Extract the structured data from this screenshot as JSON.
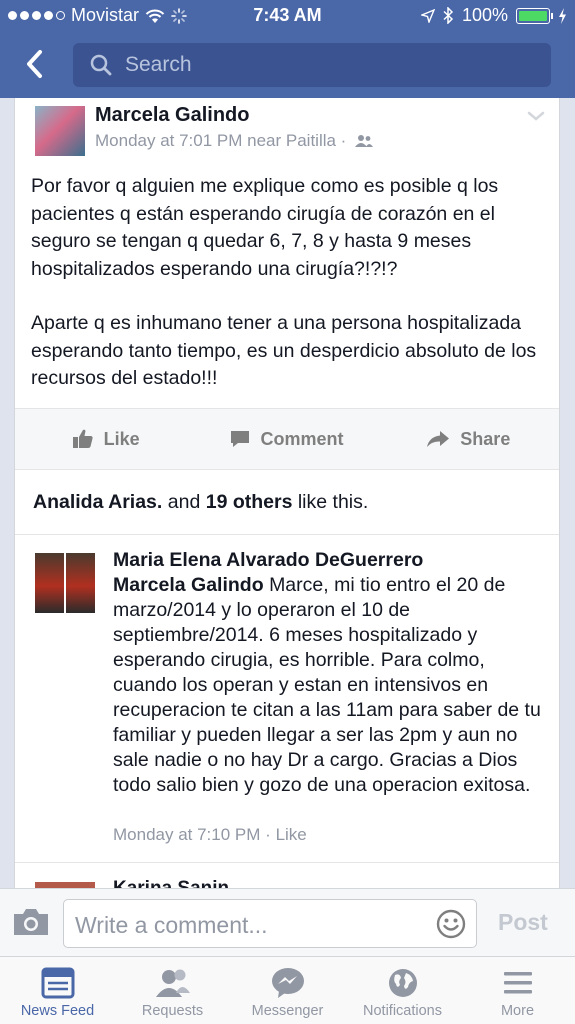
{
  "status_bar": {
    "carrier": "Movistar",
    "time": "7:43 AM",
    "battery": "100%"
  },
  "header": {
    "search_placeholder": "Search"
  },
  "post": {
    "author": "Marcela Galindo",
    "meta": "Monday at 7:01 PM near Paitilla ·",
    "paragraphs": [
      "Por favor q alguien me explique como es posible q los pacientes q están esperando cirugía de corazón en el seguro se tengan q quedar 6, 7, 8 y hasta 9 meses hospitalizados esperando una cirugía?!?!?",
      "Aparte q es inhumano tener a una persona hospitalizada esperando tanto tiempo, es un desperdicio absoluto de los recursos del estado!!!"
    ],
    "actions": {
      "like": "Like",
      "comment": "Comment",
      "share": "Share"
    },
    "likes": {
      "first": "Analida Arias.",
      "and": "and",
      "others": "19 others",
      "suffix": "like this."
    }
  },
  "comment": {
    "author": "Maria Elena Alvarado DeGuerrero",
    "mention": "Marcela Galindo",
    "text": "Marce, mi tio entro el 20 de marzo/2014 y lo operaron el 10 de septiembre/2014. 6 meses hospitalizado y esperando cirugia, es horrible. Para colmo, cuando los operan y estan en intensivos en recuperacion te citan a las 11am para saber de tu familiar y pueden llegar a ser las 2pm y aun no sale nadie o no hay Dr a cargo. Gracias a Dios todo salio bien y gozo de una operacion exitosa.",
    "time": "Monday at 7:10 PM",
    "dot": "·",
    "like": "Like"
  },
  "next_comment": {
    "author": "Karina Sanin"
  },
  "comment_bar": {
    "placeholder": "Write a comment...",
    "post_label": "Post"
  },
  "tabs": [
    {
      "label": "News Feed",
      "icon": "news-feed-icon",
      "active": true
    },
    {
      "label": "Requests",
      "icon": "friend-requests-icon",
      "active": false
    },
    {
      "label": "Messenger",
      "icon": "messenger-icon",
      "active": false
    },
    {
      "label": "Notifications",
      "icon": "globe-icon",
      "active": false
    },
    {
      "label": "More",
      "icon": "menu-icon",
      "active": false
    }
  ],
  "colors": {
    "brand": "#4a67a8",
    "search_bg": "#3b5491",
    "battery": "#4cd964",
    "meta_text": "#9197a3"
  }
}
